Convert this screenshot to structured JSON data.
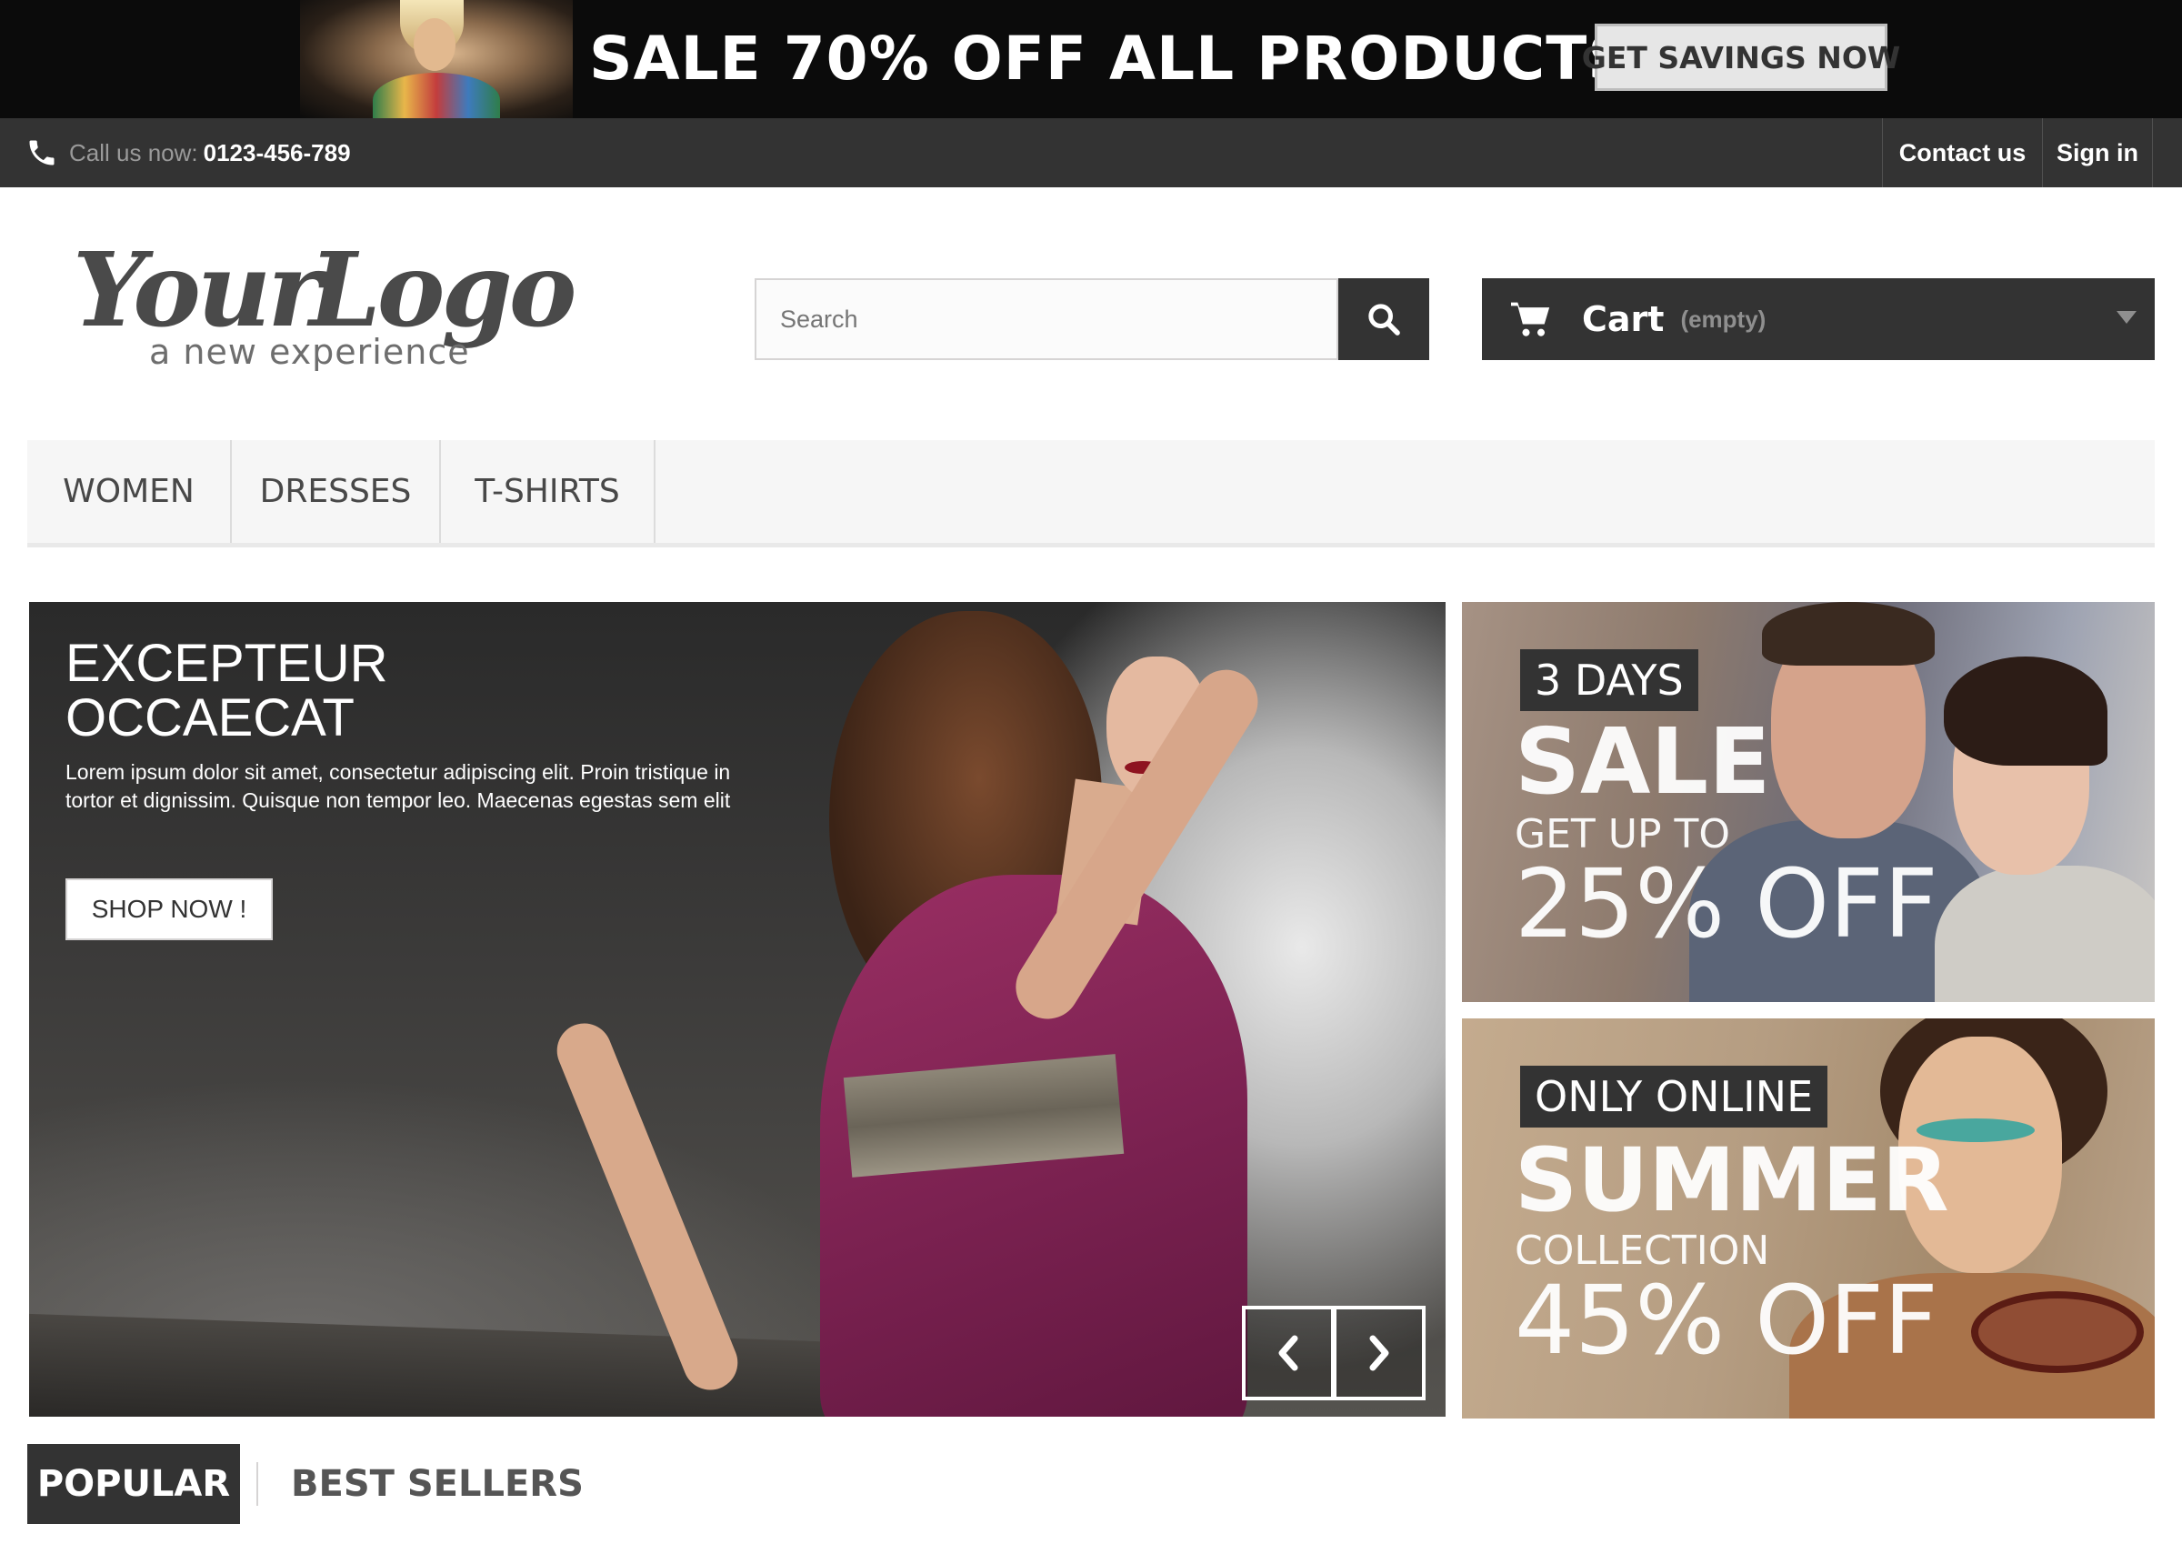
{
  "promo_banner": {
    "text": "SALE 70% OFF ALL PRODUCTS",
    "button": "GET SAVINGS NOW"
  },
  "nav": {
    "call_label": "Call us now:",
    "phone": "0123-456-789",
    "contact": "Contact us",
    "signin": "Sign in",
    "phone_icon": "phone-icon"
  },
  "header": {
    "logo_main": "YourLogo",
    "logo_tagline": "a new experience",
    "search_placeholder": "Search",
    "search_icon": "search-icon",
    "cart_label": "Cart",
    "cart_status": "(empty)",
    "cart_icon": "cart-icon"
  },
  "menu": {
    "items": [
      "WOMEN",
      "DRESSES",
      "T-SHIRTS"
    ]
  },
  "hero": {
    "title_line1": "EXCEPTEUR",
    "title_line2": "OCCAECAT",
    "description": "Lorem ipsum dolor sit amet, consectetur adipiscing elit. Proin tristique in tortor et dignissim. Quisque non tempor leo. Maecenas egestas sem elit",
    "button": "SHOP NOW !"
  },
  "banners": [
    {
      "tag": "3 DAYS",
      "line1": "SALE",
      "line2": "GET UP TO",
      "line3": "25% OFF"
    },
    {
      "tag": "ONLY ONLINE",
      "line1": "SUMMER",
      "line2": "COLLECTION",
      "line3": "45% OFF"
    }
  ],
  "tabs": {
    "popular": "POPULAR",
    "best_sellers": "BEST SELLERS"
  },
  "colors": {
    "dark": "#333333",
    "menu_bg": "#f6f6f6",
    "promo_bg": "#0b0b0b"
  }
}
